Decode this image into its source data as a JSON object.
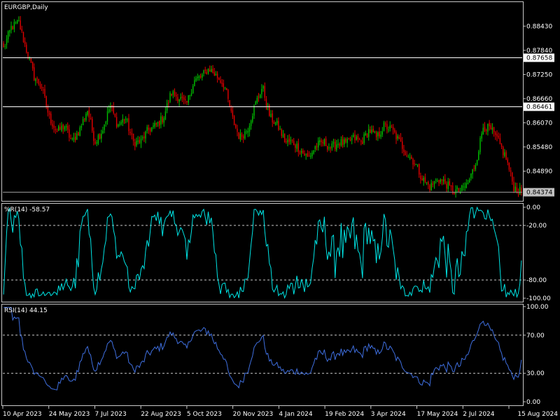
{
  "colors": {
    "background": "#000000",
    "grid": "#c8c8c8",
    "bull": "#00c000",
    "bear": "#e00000",
    "williams": "#00e5e5",
    "rsi": "#3f6fe0",
    "level_line": "#ffffff",
    "price_tag_bg": "#ffffff",
    "price_tag_text": "#000000",
    "current_tag_bg": "#c0c0c0"
  },
  "main_panel": {
    "title": "EURGBP,Daily",
    "y_ticks": [
      "0.88430",
      "0.87840",
      "0.87250",
      "0.86660",
      "0.86070",
      "0.85480",
      "0.84890"
    ],
    "y_tick_values": [
      0.8843,
      0.8784,
      0.8725,
      0.8666,
      0.8607,
      0.8548,
      0.8489
    ],
    "ylim": [
      0.8418,
      0.89
    ],
    "level_lines": [
      {
        "label": "0.87658",
        "value": 0.87658
      },
      {
        "label": "0.86461",
        "value": 0.86461
      }
    ],
    "current_price": {
      "label": "0.84374",
      "value": 0.84374
    }
  },
  "williams_panel": {
    "title": "%R(14) -58.57",
    "y_ticks": [
      "0.00",
      "-20.00",
      "-80.00",
      "-100.00"
    ],
    "y_tick_values": [
      0,
      -20,
      -80,
      -100
    ],
    "levels": [
      -20,
      -80
    ],
    "ylim": [
      -100,
      0
    ]
  },
  "rsi_panel": {
    "title": "RSI(14) 44.15",
    "y_ticks": [
      "100.00",
      "70.00",
      "30.00",
      "0.00"
    ],
    "y_tick_values": [
      100,
      70,
      30,
      0
    ],
    "levels": [
      70,
      30
    ],
    "ylim": [
      0,
      100
    ]
  },
  "x_axis": {
    "labels": [
      "10 Apr 2023",
      "24 May 2023",
      "7 Jul 2023",
      "22 Aug 2023",
      "5 Oct 2023",
      "20 Nov 2023",
      "4 Jan 2024",
      "19 Feb 2024",
      "3 Apr 2024",
      "17 May 2024",
      "2 Jul 2024",
      "15 Aug 2024"
    ]
  },
  "chart_data": {
    "type": "candlestick",
    "symbol": "EURGBP",
    "timeframe": "Daily",
    "x_range": [
      "10 Apr 2023",
      "15 Aug 2024"
    ],
    "close_path": [
      [
        "10 Apr 2023",
        0.8788
      ],
      [
        "17 Apr 2023",
        0.884
      ],
      [
        "24 Apr 2023",
        0.8852
      ],
      [
        "1 May 2023",
        0.8785
      ],
      [
        "8 May 2023",
        0.872
      ],
      [
        "15 May 2023",
        0.8695
      ],
      [
        "24 May 2023",
        0.862
      ],
      [
        "31 May 2023",
        0.8585
      ],
      [
        "7 Jun 2023",
        0.86
      ],
      [
        "14 Jun 2023",
        0.856
      ],
      [
        "21 Jun 2023",
        0.859
      ],
      [
        "28 Jun 2023",
        0.864
      ],
      [
        "7 Jul 2023",
        0.856
      ],
      [
        "14 Jul 2023",
        0.859
      ],
      [
        "21 Jul 2023",
        0.865
      ],
      [
        "28 Jul 2023",
        0.86
      ],
      [
        "4 Aug 2023",
        0.862
      ],
      [
        "11 Aug 2023",
        0.856
      ],
      [
        "22 Aug 2023",
        0.856
      ],
      [
        "29 Aug 2023",
        0.859
      ],
      [
        "5 Sep 2023",
        0.86
      ],
      [
        "12 Sep 2023",
        0.862
      ],
      [
        "19 Sep 2023",
        0.868
      ],
      [
        "26 Sep 2023",
        0.867
      ],
      [
        "5 Oct 2023",
        0.865
      ],
      [
        "12 Oct 2023",
        0.871
      ],
      [
        "19 Oct 2023",
        0.872
      ],
      [
        "26 Oct 2023",
        0.874
      ],
      [
        "2 Nov 2023",
        0.872
      ],
      [
        "9 Nov 2023",
        0.87
      ],
      [
        "20 Nov 2023",
        0.862
      ],
      [
        "27 Nov 2023",
        0.857
      ],
      [
        "4 Dec 2023",
        0.859
      ],
      [
        "11 Dec 2023",
        0.865
      ],
      [
        "18 Dec 2023",
        0.8695
      ],
      [
        "27 Dec 2023",
        0.862
      ],
      [
        "4 Jan 2024",
        0.86
      ],
      [
        "11 Jan 2024",
        0.856
      ],
      [
        "18 Jan 2024",
        0.856
      ],
      [
        "25 Jan 2024",
        0.854
      ],
      [
        "1 Feb 2024",
        0.852
      ],
      [
        "8 Feb 2024",
        0.855
      ],
      [
        "19 Feb 2024",
        0.856
      ],
      [
        "26 Feb 2024",
        0.8545
      ],
      [
        "4 Mar 2024",
        0.856
      ],
      [
        "11 Mar 2024",
        0.8555
      ],
      [
        "18 Mar 2024",
        0.857
      ],
      [
        "25 Mar 2024",
        0.856
      ],
      [
        "3 Apr 2024",
        0.859
      ],
      [
        "10 Apr 2024",
        0.857
      ],
      [
        "17 Apr 2024",
        0.86
      ],
      [
        "24 Apr 2024",
        0.859
      ],
      [
        "1 May 2024",
        0.856
      ],
      [
        "8 May 2024",
        0.853
      ],
      [
        "17 May 2024",
        0.851
      ],
      [
        "24 May 2024",
        0.847
      ],
      [
        "31 May 2024",
        0.845
      ],
      [
        "7 Jun 2024",
        0.847
      ],
      [
        "14 Jun 2024",
        0.846
      ],
      [
        "21 Jun 2024",
        0.844
      ],
      [
        "2 Jul 2024",
        0.844
      ],
      [
        "9 Jul 2024",
        0.846
      ],
      [
        "16 Jul 2024",
        0.851
      ],
      [
        "23 Jul 2024",
        0.86
      ],
      [
        "30 Jul 2024",
        0.859
      ],
      [
        "6 Aug 2024",
        0.856
      ],
      [
        "15 Aug 2024",
        0.852
      ],
      [
        "22 Aug 2024",
        0.845
      ],
      [
        "29 Aug 2024",
        0.8437
      ]
    ],
    "indicators": [
      {
        "name": "%R(14)",
        "last": -58.57
      },
      {
        "name": "RSI(14)",
        "last": 44.15
      }
    ]
  }
}
